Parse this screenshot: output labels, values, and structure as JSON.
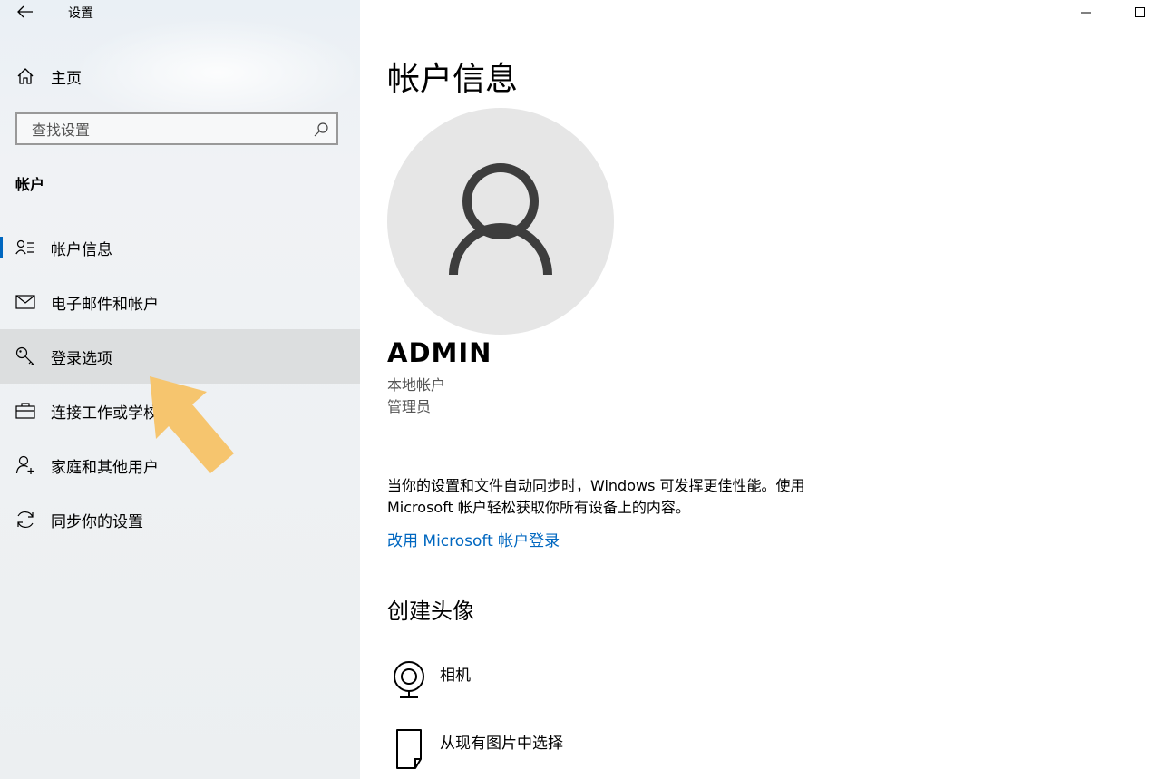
{
  "window": {
    "title": "设置"
  },
  "sidebar": {
    "home_label": "主页",
    "search_placeholder": "查找设置",
    "section_title": "帐户",
    "items": [
      {
        "label": "帐户信息",
        "icon": "account-info-icon",
        "selected": true
      },
      {
        "label": "电子邮件和帐户",
        "icon": "mail-icon"
      },
      {
        "label": "登录选项",
        "icon": "key-icon",
        "hover": true
      },
      {
        "label": "连接工作或学校",
        "icon": "briefcase-icon"
      },
      {
        "label": "家庭和其他用户",
        "icon": "person-add-icon"
      },
      {
        "label": "同步你的设置",
        "icon": "sync-icon"
      }
    ]
  },
  "main": {
    "title": "帐户信息",
    "user": {
      "name": "ADMIN",
      "account_type": "本地帐户",
      "role": "管理员"
    },
    "description_line1": "当你的设置和文件自动同步时，Windows 可发挥更佳性能。使用",
    "description_line2": "Microsoft 帐户轻松获取你所有设备上的内容。",
    "ms_link": "改用 Microsoft 帐户登录",
    "create_avatar": {
      "heading": "创建头像",
      "options": [
        {
          "label": "相机",
          "icon": "webcam-icon"
        },
        {
          "label": "从现有图片中选择",
          "icon": "browse-file-icon"
        }
      ]
    }
  },
  "colors": {
    "accent": "#0067c0",
    "sidebar_bg": "#eef1f3",
    "hover_bg": "#dcdedf",
    "avatar_bg": "#e6e6e6",
    "pointer": "#f6c56e"
  }
}
